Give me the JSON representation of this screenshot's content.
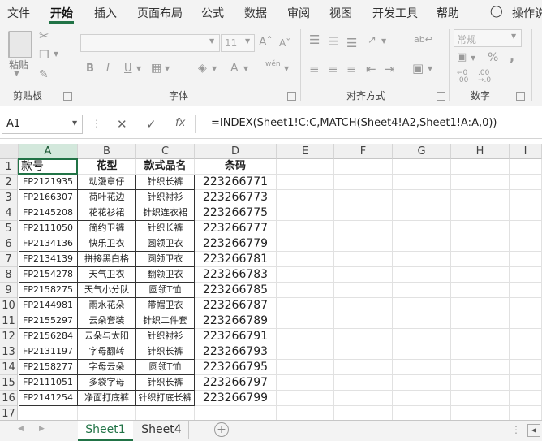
{
  "menu": [
    "文件",
    "开始",
    "插入",
    "页面布局",
    "公式",
    "数据",
    "审阅",
    "视图",
    "开发工具",
    "帮助",
    "操作说"
  ],
  "ribbon": {
    "clipboard_paste": "粘贴",
    "groups": [
      "剪贴板",
      "字体",
      "对齐方式",
      "数字"
    ],
    "font_size": "11",
    "number_format": "常规",
    "bold": "B",
    "italic": "I",
    "underline": "U",
    "percent": "%",
    "comma": ",",
    "wen": "wén"
  },
  "formula_bar": {
    "name_box": "A1",
    "cancel": "✕",
    "enter": "✓",
    "fx": "fx",
    "formula": "=INDEX(Sheet1!C:C,MATCH(Sheet4!A2,Sheet1!A:A,0))"
  },
  "columns": [
    "A",
    "B",
    "C",
    "D",
    "E",
    "F",
    "G",
    "H",
    "I"
  ],
  "headers": {
    "A": "款号",
    "B": "花型",
    "C": "款式品名",
    "D": "条码"
  },
  "rows": [
    {
      "n": "2",
      "a": "FP2121935",
      "b": "动漫章仔",
      "c": "针织长裤",
      "d": "223266771"
    },
    {
      "n": "3",
      "a": "FP2166307",
      "b": "荷叶花边",
      "c": "针织衬衫",
      "d": "223266773"
    },
    {
      "n": "4",
      "a": "FP2145208",
      "b": "花花衫裙",
      "c": "针织连衣裙",
      "d": "223266775"
    },
    {
      "n": "5",
      "a": "FP2111050",
      "b": "简约卫裤",
      "c": "针织长裤",
      "d": "223266777"
    },
    {
      "n": "6",
      "a": "FP2134136",
      "b": "快乐卫衣",
      "c": "圆领卫衣",
      "d": "223266779"
    },
    {
      "n": "7",
      "a": "FP2134139",
      "b": "拼接黑白格",
      "c": "圆领卫衣",
      "d": "223266781"
    },
    {
      "n": "8",
      "a": "FP2154278",
      "b": "天气卫衣",
      "c": "翻领卫衣",
      "d": "223266783"
    },
    {
      "n": "9",
      "a": "FP2158275",
      "b": "天气小分队",
      "c": "圆领T恤",
      "d": "223266785"
    },
    {
      "n": "10",
      "a": "FP2144981",
      "b": "雨水花朵",
      "c": "带帽卫衣",
      "d": "223266787"
    },
    {
      "n": "11",
      "a": "FP2155297",
      "b": "云朵套装",
      "c": "针织二件套",
      "d": "223266789"
    },
    {
      "n": "12",
      "a": "FP2156284",
      "b": "云朵与太阳",
      "c": "针织衬衫",
      "d": "223266791"
    },
    {
      "n": "13",
      "a": "FP2131197",
      "b": "字母翻转",
      "c": "针织长裤",
      "d": "223266793"
    },
    {
      "n": "14",
      "a": "FP2158277",
      "b": "字母云朵",
      "c": "圆领T恤",
      "d": "223266795"
    },
    {
      "n": "15",
      "a": "FP2111051",
      "b": "多袋字母",
      "c": "针织长裤",
      "d": "223266797"
    },
    {
      "n": "16",
      "a": "FP2141254",
      "b": "净面打底裤",
      "c": "针织打底长裤",
      "d": "223266799"
    }
  ],
  "row_labels": {
    "first": "1",
    "last": "17"
  },
  "tabs": [
    "Sheet1",
    "Sheet4"
  ],
  "add_sheet": "+",
  "accent": "#217346"
}
